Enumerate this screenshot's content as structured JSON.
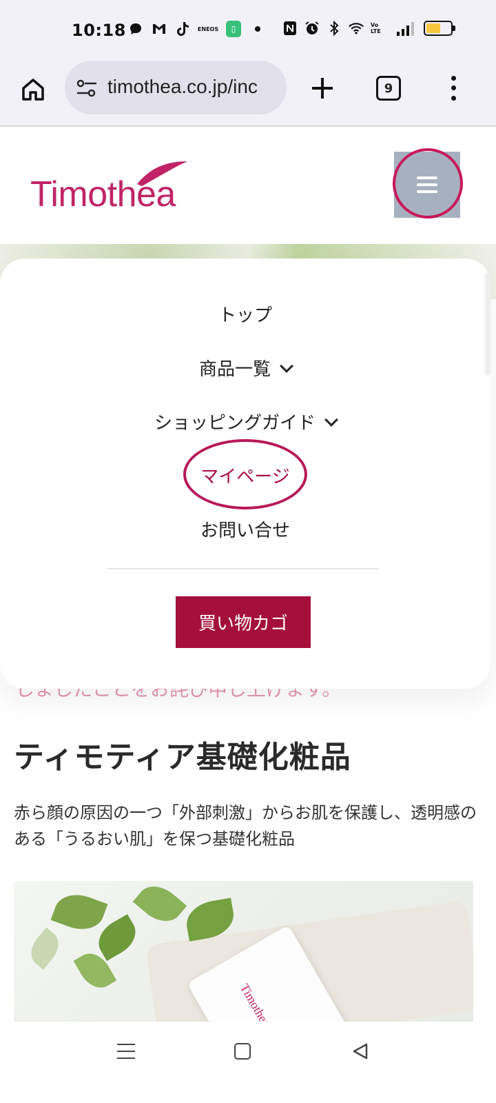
{
  "status_bar": {
    "time": "10:18",
    "left_icons": [
      "chat-bubble-icon",
      "gmail-icon",
      "tiktok-icon",
      "eneos-icon",
      "app-green-icon",
      "dot-icon"
    ],
    "eneos_label": "ENEOS",
    "right_icons": [
      "nfc-icon",
      "alarm-icon",
      "bluetooth-icon",
      "wifi-icon",
      "volte-icon",
      "signal-icon",
      "battery-icon"
    ],
    "volte_label": "Vo LTE",
    "battery_level": 0.6,
    "battery_color": "#f6c63d"
  },
  "browser": {
    "url": "timothea.co.jp/inc",
    "tab_count": "9"
  },
  "site": {
    "logo_text": "Timothea",
    "brand_color": "#c02466"
  },
  "menu": {
    "items": [
      {
        "label": "トップ"
      },
      {
        "label": "商品一覧"
      },
      {
        "label": "ショッピングガイド"
      },
      {
        "label": "マイページ"
      },
      {
        "label": "お問い合せ"
      }
    ],
    "cart_button": "買い物カゴ",
    "cart_color": "#a5103b"
  },
  "content": {
    "peek_text": "しましたことをお詫び申し上げます。",
    "section_title": "ティモティア基礎化粧品",
    "section_desc": "赤ら顔の原因の一つ「外部刺激」からお肌を保護し、透明感のある「うるおい肌」を保つ基礎化粧品",
    "product_brand": "Timothea"
  }
}
